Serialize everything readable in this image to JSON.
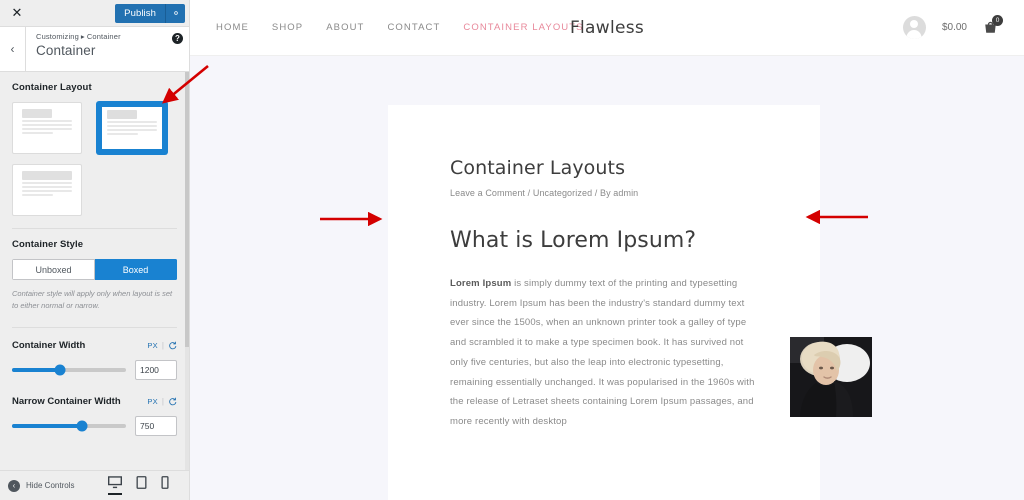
{
  "customizer": {
    "close_label": "✕",
    "publish_label": "Publish",
    "gear_icon": "gear-icon",
    "breadcrumb_root": "Customizing",
    "breadcrumb_sep": "▸",
    "breadcrumb_current": "Container",
    "panel_title": "Container",
    "help_label": "?",
    "back_label": "‹",
    "sections": {
      "layout": {
        "label": "Container Layout",
        "options": [
          {
            "name": "normal",
            "selected": false
          },
          {
            "name": "narrow",
            "selected": true
          },
          {
            "name": "full-width",
            "selected": false
          }
        ]
      },
      "style": {
        "label": "Container Style",
        "options": [
          {
            "label": "Unboxed",
            "selected": false
          },
          {
            "label": "Boxed",
            "selected": true
          }
        ],
        "note": "Container style will apply only when layout is set to either normal or narrow."
      },
      "container_width": {
        "label": "Container Width",
        "unit": "PX",
        "reset_icon": "reset-icon",
        "value": "1200",
        "percent": 42
      },
      "narrow_container_width": {
        "label": "Narrow Container Width",
        "unit": "PX",
        "reset_icon": "reset-icon",
        "value": "750",
        "percent": 61
      }
    },
    "footer": {
      "hide_controls_label": "Hide Controls",
      "devices": [
        {
          "name": "desktop",
          "active": true
        },
        {
          "name": "tablet",
          "active": false
        },
        {
          "name": "mobile",
          "active": false
        }
      ]
    }
  },
  "site": {
    "nav": [
      {
        "label": "HOME",
        "active": false
      },
      {
        "label": "SHOP",
        "active": false
      },
      {
        "label": "ABOUT",
        "active": false
      },
      {
        "label": "CONTACT",
        "active": false
      },
      {
        "label": "CONTAINER LAYOUTS",
        "active": true
      }
    ],
    "brand": "Flawless",
    "cart_total": "$0.00",
    "cart_count": "0",
    "post": {
      "title": "Container Layouts",
      "meta": "Leave a Comment / Uncategorized / By admin",
      "heading": "What is Lorem Ipsum?",
      "body_lead": "Lorem Ipsum",
      "body": " is simply dummy text of the printing and typesetting industry. Lorem Ipsum has been the industry's standard dummy text ever since the 1500s, when an unknown printer took a galley of type and scrambled it to make a type specimen book. It has survived not only five centuries, but also the leap into electronic typesetting, remaining essentially unchanged. It was popularised in the 1960s with the release of Letraset sheets containing Lorem Ipsum passages, and more recently with desktop",
      "photo_alt": "portrait-photo"
    }
  },
  "annotations": {
    "accent_color": "#d40000",
    "arrows": [
      {
        "name": "arrow-to-selected-layout",
        "direction": "down-left"
      },
      {
        "name": "arrow-to-container-left-edge",
        "direction": "right"
      },
      {
        "name": "arrow-to-container-right-edge",
        "direction": "left"
      }
    ]
  },
  "colors": {
    "customizer_bg": "#eeeeee",
    "wp_blue": "#2271b1",
    "control_blue": "#1982d1",
    "preview_bg": "#f6f6fb",
    "nav_active": "#e8899b"
  }
}
